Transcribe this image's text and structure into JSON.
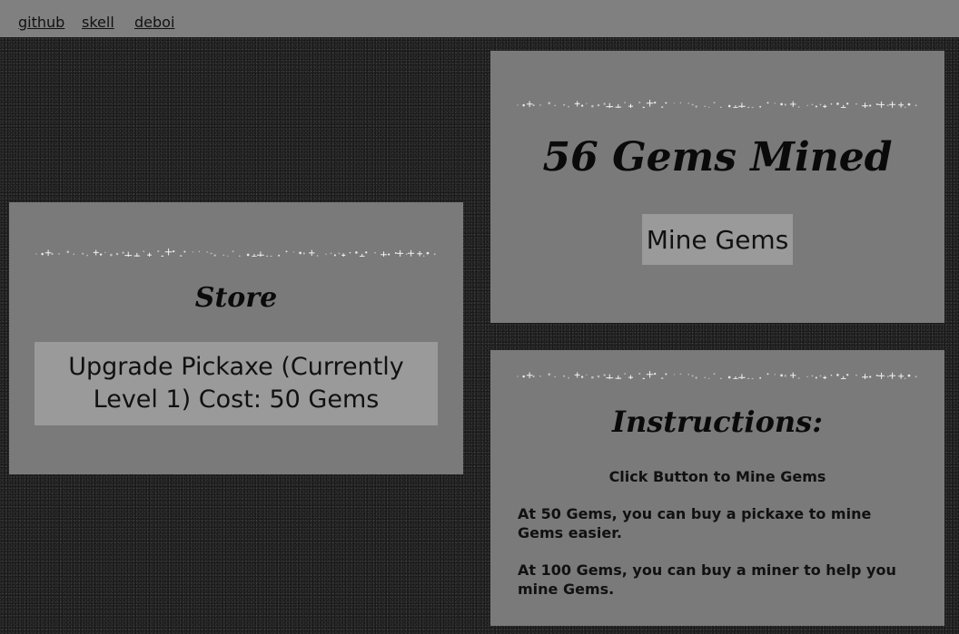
{
  "nav": {
    "links": [
      "github",
      "skell",
      "deboi"
    ]
  },
  "mine_panel": {
    "count_text": "56 Gems Mined",
    "button_label": "Mine Gems"
  },
  "store_panel": {
    "title": "Store",
    "upgrade_button_label": "Upgrade Pickaxe (Currently Level 1) Cost: 50 Gems"
  },
  "instructions_panel": {
    "title": "Instructions:",
    "lines": [
      "Click Button to Mine Gems",
      "At 50 Gems, you can buy a pickaxe to mine Gems easier.",
      "At 100 Gems, you can buy a miner to help you mine Gems."
    ]
  },
  "colors": {
    "page_background": "#1a1a1a",
    "nav_background": "#808080",
    "panel_background": "#7a7a7a",
    "button_background": "#9a9a9a"
  }
}
